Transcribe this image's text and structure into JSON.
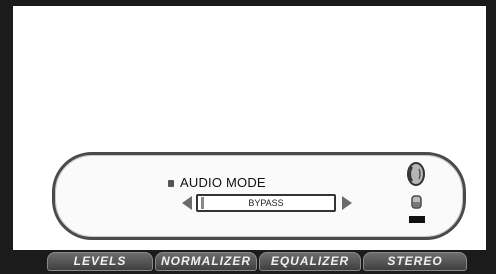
{
  "panel": {
    "mode_label": "AUDIO MODE",
    "mode_value": "BYPASS"
  },
  "icons": {
    "top": "speaker-head-icon",
    "bottom": "lock-icon"
  },
  "tabs": [
    {
      "label": "LEVELS"
    },
    {
      "label": "NORMALIZER"
    },
    {
      "label": "EQUALIZER"
    },
    {
      "label": "STEREO"
    }
  ]
}
